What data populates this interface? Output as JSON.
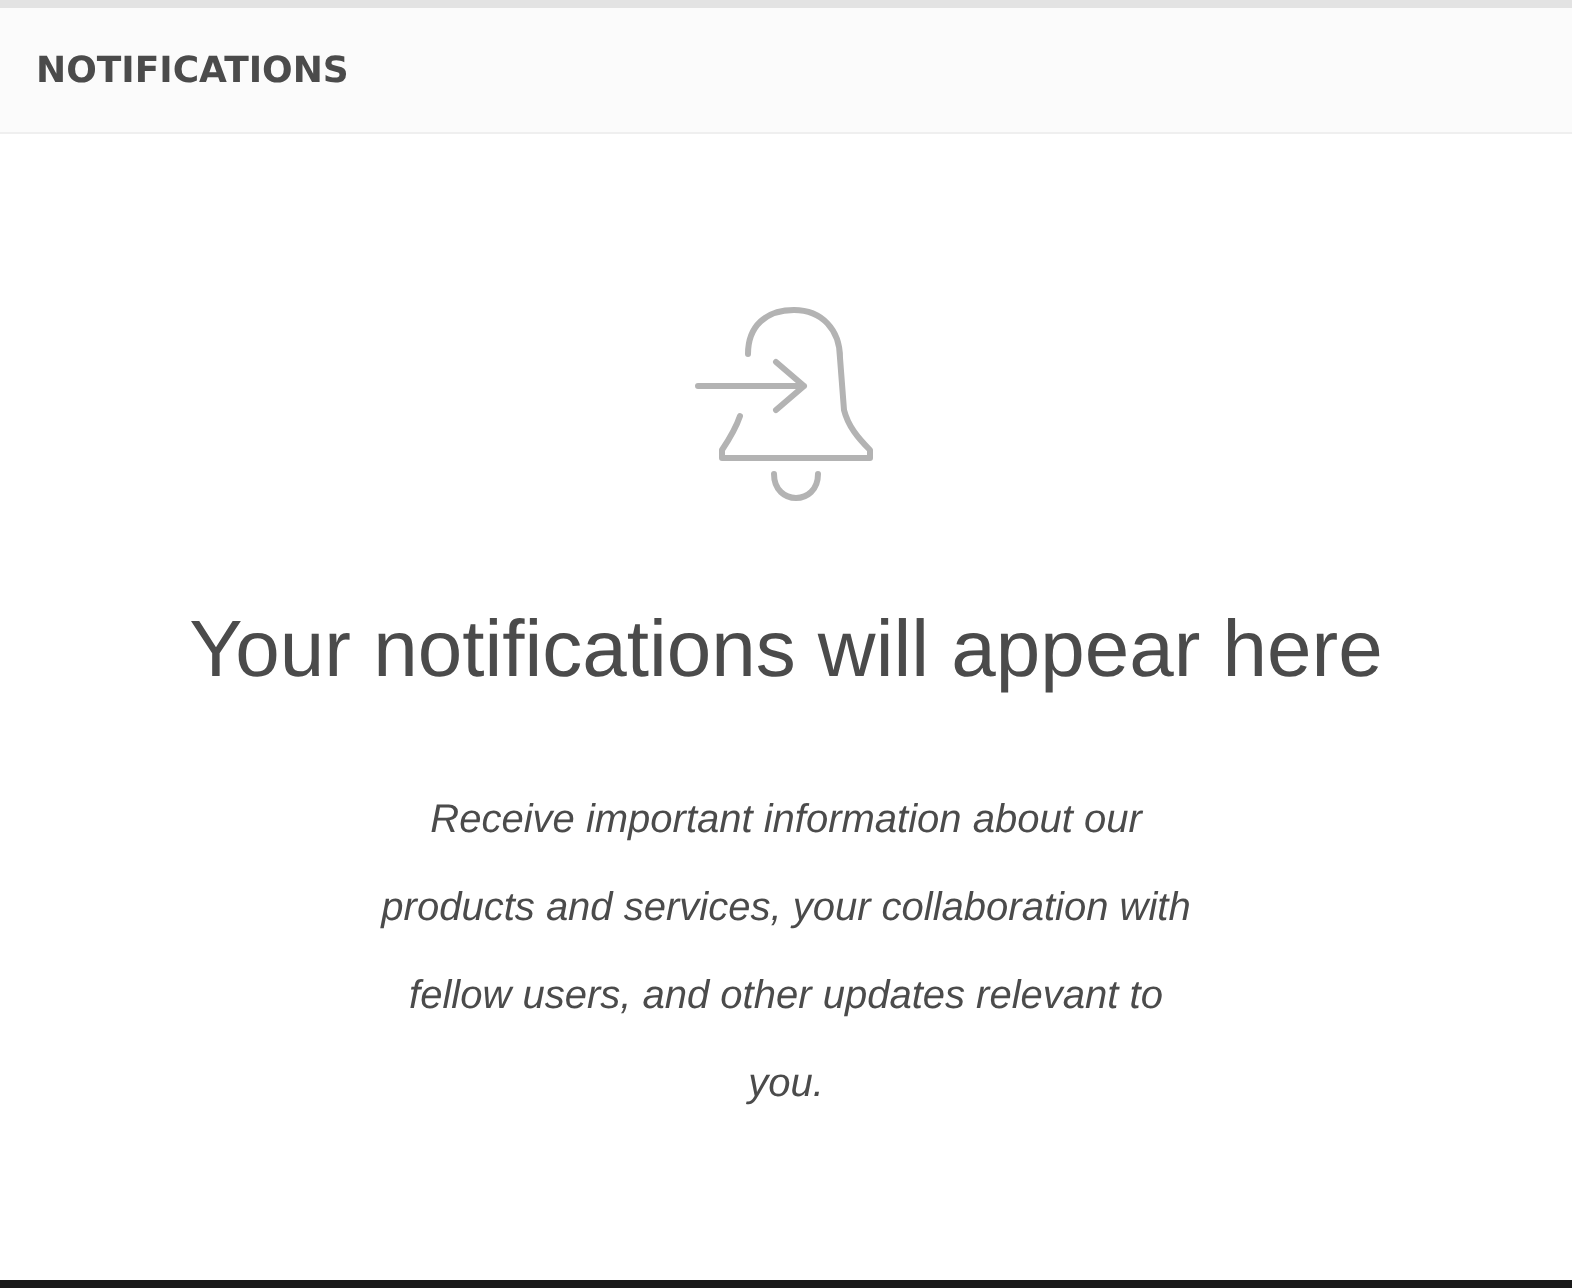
{
  "header": {
    "title": "NOTIFICATIONS"
  },
  "empty_state": {
    "heading": "Your notifications will appear here",
    "message": "Receive important information about our products and services, your collaboration with fellow users, and other updates relevant to you."
  }
}
